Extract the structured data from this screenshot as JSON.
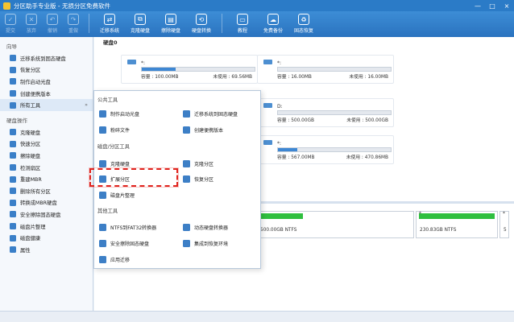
{
  "window": {
    "title": "分区助手专业版 - 无损分区免费软件",
    "controls": [
      "—",
      "□",
      "×"
    ]
  },
  "toolbar": {
    "buttons": [
      {
        "label": "提交",
        "icon": "check-icon"
      },
      {
        "label": "放弃",
        "icon": "cancel-icon"
      },
      {
        "label": "撤销",
        "icon": "undo-icon"
      },
      {
        "label": "重做",
        "icon": "redo-icon"
      },
      {
        "label": "迁移系统",
        "icon": "migrate-icon"
      },
      {
        "label": "克隆硬盘",
        "icon": "clone-disk-icon"
      },
      {
        "label": "擦除硬盘",
        "icon": "wipe-disk-icon"
      },
      {
        "label": "硬盘转换",
        "icon": "convert-icon"
      },
      {
        "label": "教程",
        "icon": "tutorial-icon"
      },
      {
        "label": "免费备份",
        "icon": "backup-icon"
      },
      {
        "label": "固态恢复",
        "icon": "recover-icon"
      }
    ]
  },
  "sidebar": {
    "wizard_title": "向导",
    "wizard_items": [
      "迁移系统到固态硬盘",
      "恢复分区",
      "制作启动光盘",
      "创建便携版本",
      "所有工具"
    ],
    "ops_title": "硬盘操作",
    "ops_items": [
      "克隆硬盘",
      "快速分区",
      "擦除硬盘",
      "检测扇区",
      "重建MBR",
      "删除所有分区",
      "转换成MBR硬盘",
      "安全擦除固态硬盘",
      "磁盘片整理",
      "磁盘健康",
      "属性"
    ],
    "more_arrow": "»"
  },
  "main": {
    "disk_label": "硬盘0",
    "cards": [
      {
        "drive": "*:",
        "capacity": "容量 : 100.00MB",
        "free": "未使用 : 69.56MB",
        "fill": 0.3
      },
      {
        "drive": "*:",
        "capacity": "容量 : 16.00MB",
        "free": "未使用 : 16.00MB",
        "fill": 0.0
      },
      {
        "drive": "D:",
        "capacity": "容量 : 500.00GB",
        "free": "未使用 : 500.00GB",
        "fill": 0.0
      },
      {
        "drive": "*:",
        "capacity": "容量 : 567.00MB",
        "free": "未使用 : 470.86MB",
        "fill": 0.17
      }
    ],
    "parts": [
      {
        "text": "500.00GB NTFS"
      },
      {
        "text": "230.83GB NTFS"
      },
      {
        "text": "5"
      }
    ],
    "part_markers": [
      "*",
      "*"
    ]
  },
  "popup": {
    "groups": [
      {
        "title": "公共工具",
        "items": [
          "制作启动光盘",
          "迁移系统到固态硬盘",
          "粉碎文件",
          "创建便携版本"
        ]
      },
      {
        "title": "磁盘/分区工具",
        "items": [
          "克隆硬盘",
          "克隆分区",
          "扩展分区",
          "恢复分区",
          "磁盘片整理"
        ]
      },
      {
        "title": "其他工具",
        "items": [
          "NTFS到FAT32转换器",
          "动态硬盘转换器",
          "安全擦除固态硬盘",
          "集成到恢复环境",
          "应用迁移"
        ]
      }
    ]
  }
}
